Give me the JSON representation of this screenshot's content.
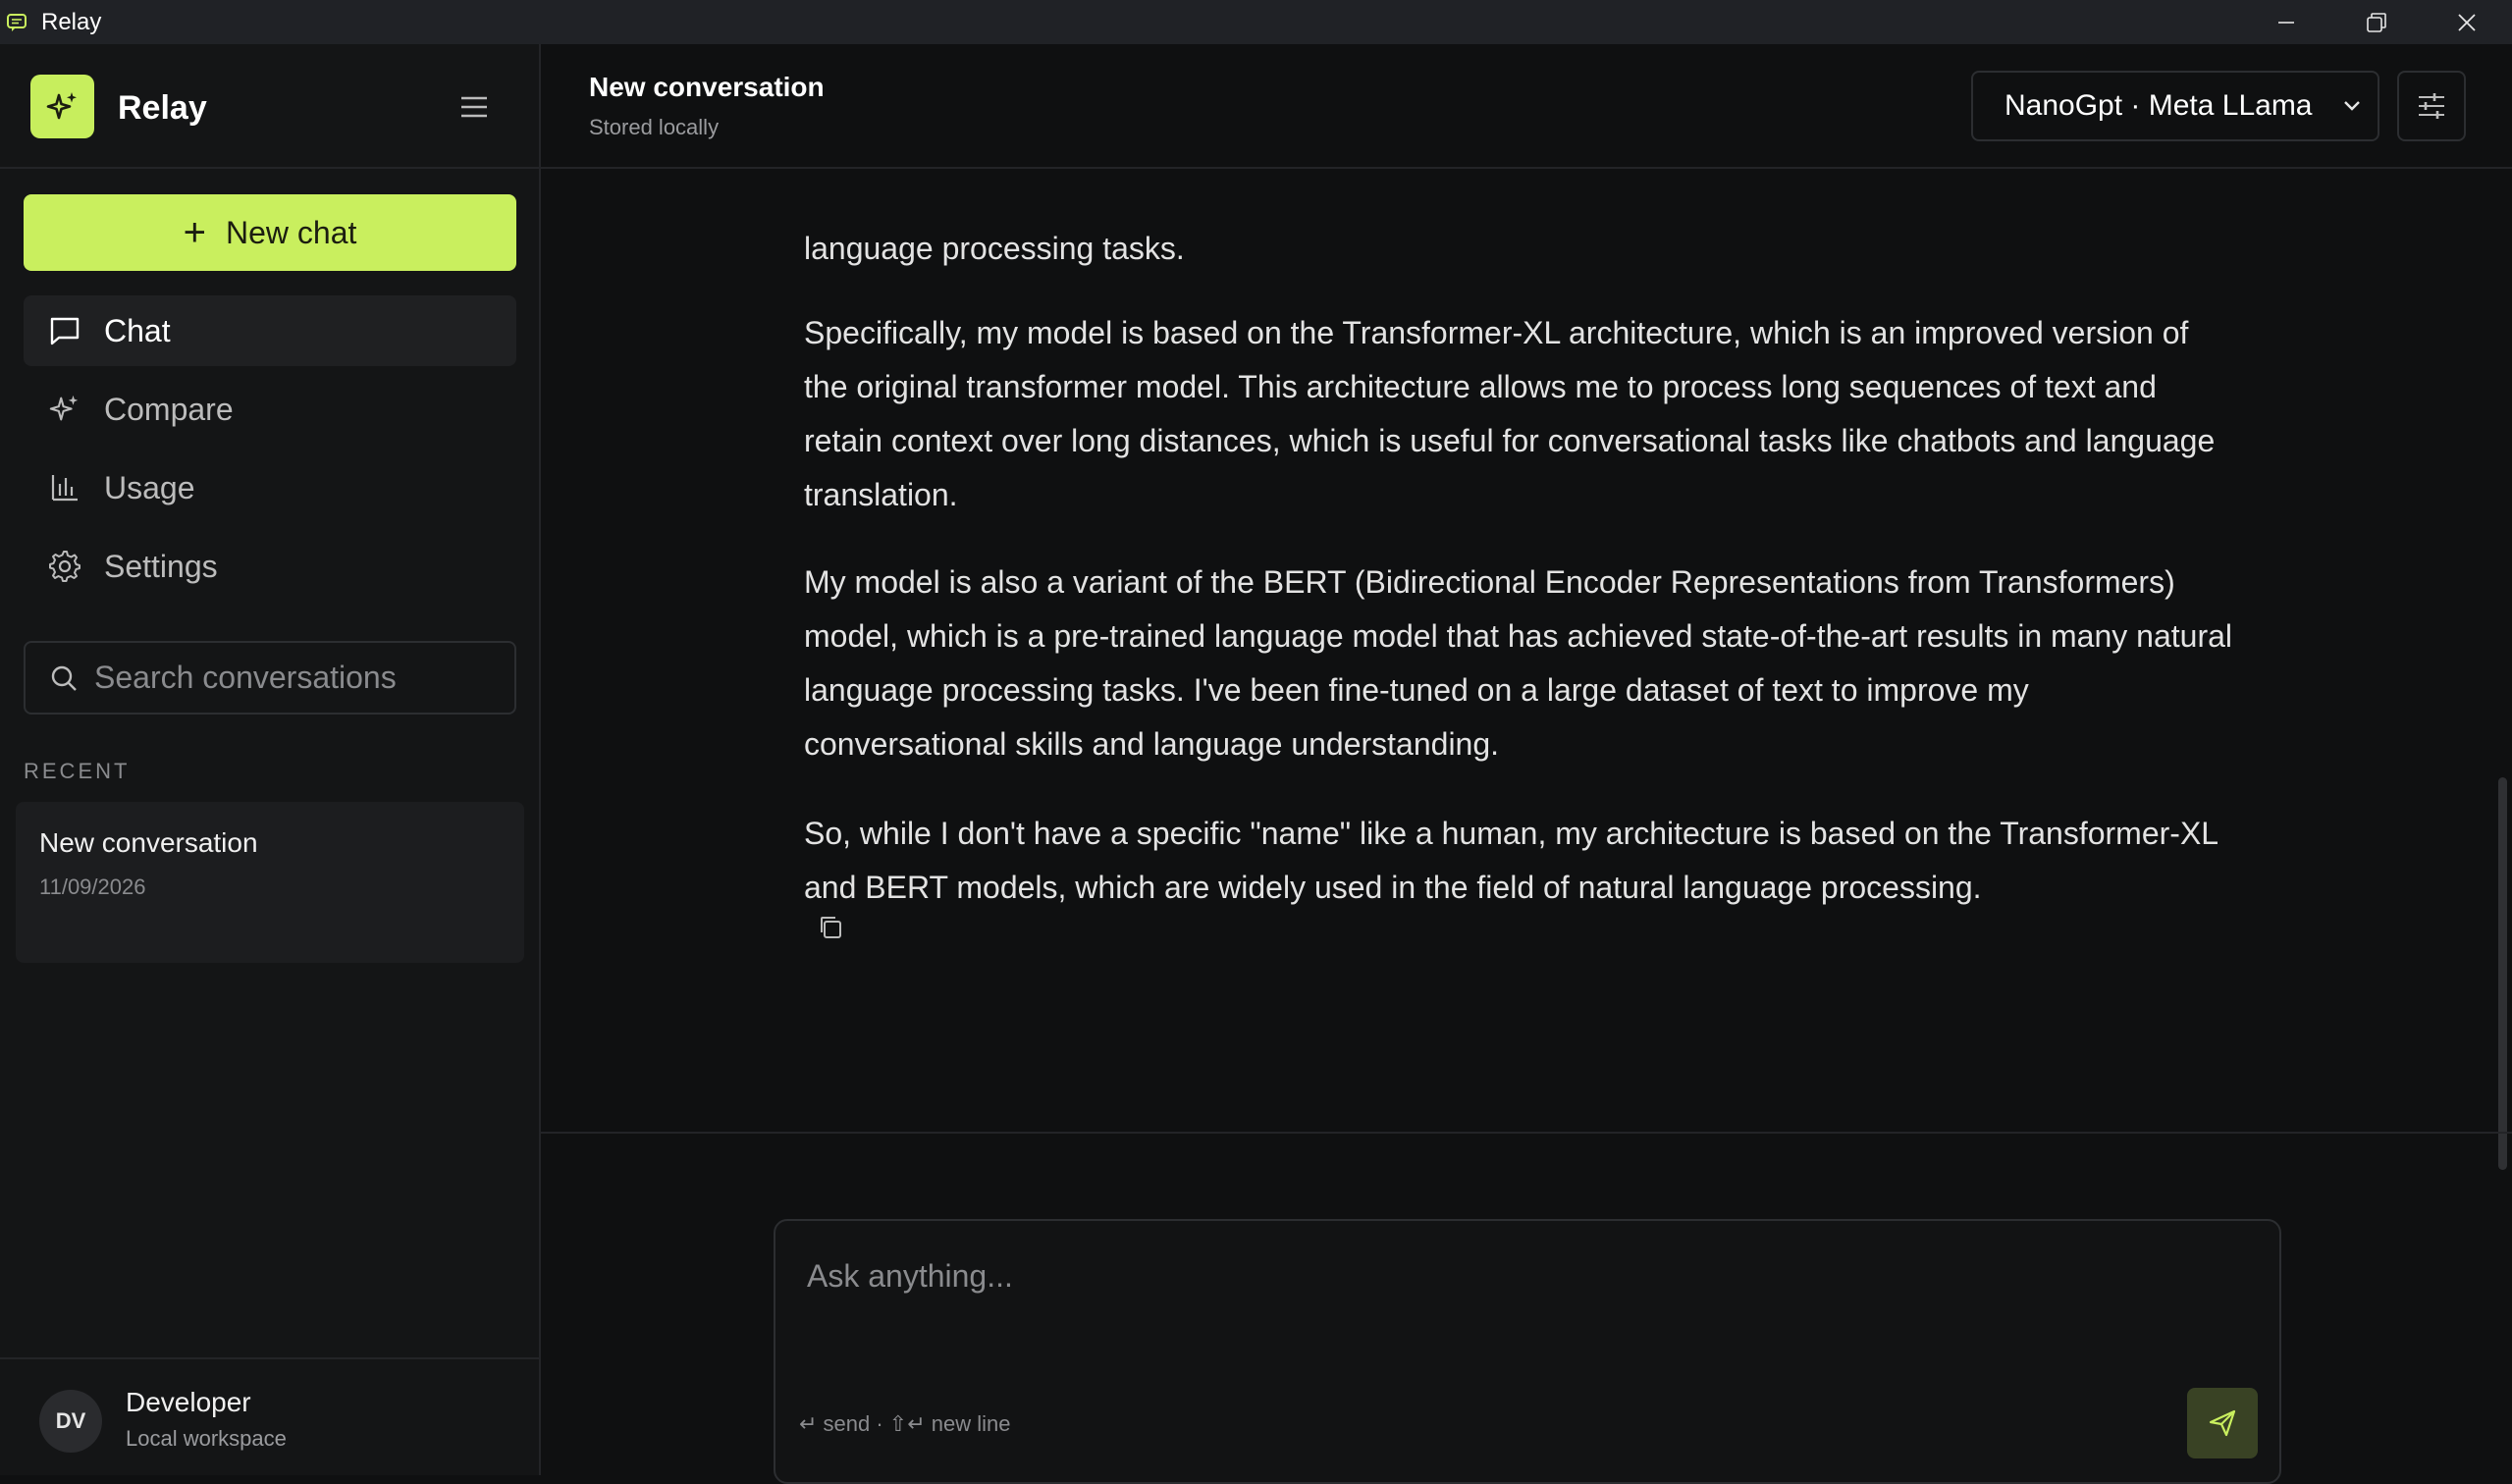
{
  "window": {
    "title": "Relay"
  },
  "sidebar": {
    "brand": "Relay",
    "new_chat_label": "New chat",
    "nav": [
      {
        "label": "Chat",
        "icon": "chat-bubble-icon",
        "active": true
      },
      {
        "label": "Compare",
        "icon": "sparkles-icon",
        "active": false
      },
      {
        "label": "Usage",
        "icon": "bar-chart-icon",
        "active": false
      },
      {
        "label": "Settings",
        "icon": "gear-icon",
        "active": false
      }
    ],
    "search_placeholder": "Search conversations",
    "recent_label": "RECENT",
    "conversations": [
      {
        "title": "New conversation",
        "date": "11/09/2026"
      }
    ],
    "user": {
      "initials": "DV",
      "name": "Developer",
      "subtitle": "Local workspace"
    }
  },
  "header": {
    "title": "New conversation",
    "subtitle": "Stored locally",
    "model": "NanoGpt · Meta LLama"
  },
  "messages": [
    "language processing tasks.",
    "Specifically, my model is based on the Transformer-XL architecture, which is an improved version of the original transformer model. This architecture allows me to process long sequences of text and retain context over long distances, which is useful for conversational tasks like chatbots and language translation.",
    "My model is also a variant of the BERT (Bidirectional Encoder Representations from Transformers) model, which is a pre-trained language model that has achieved state-of-the-art results in many natural language processing tasks. I've been fine-tuned on a large dataset of text to improve my conversational skills and language understanding.",
    "So, while I don't have a specific \"name\" like a human, my architecture is based on the Transformer-XL and BERT models, which are widely used in the field of natural language processing."
  ],
  "composer": {
    "placeholder": "Ask anything...",
    "hint": "↵ send · ⇧↵ new line"
  },
  "colors": {
    "accent": "#c9ef5e",
    "background": "#0f1011",
    "sidebar": "#141516",
    "titlebar": "#202226"
  }
}
